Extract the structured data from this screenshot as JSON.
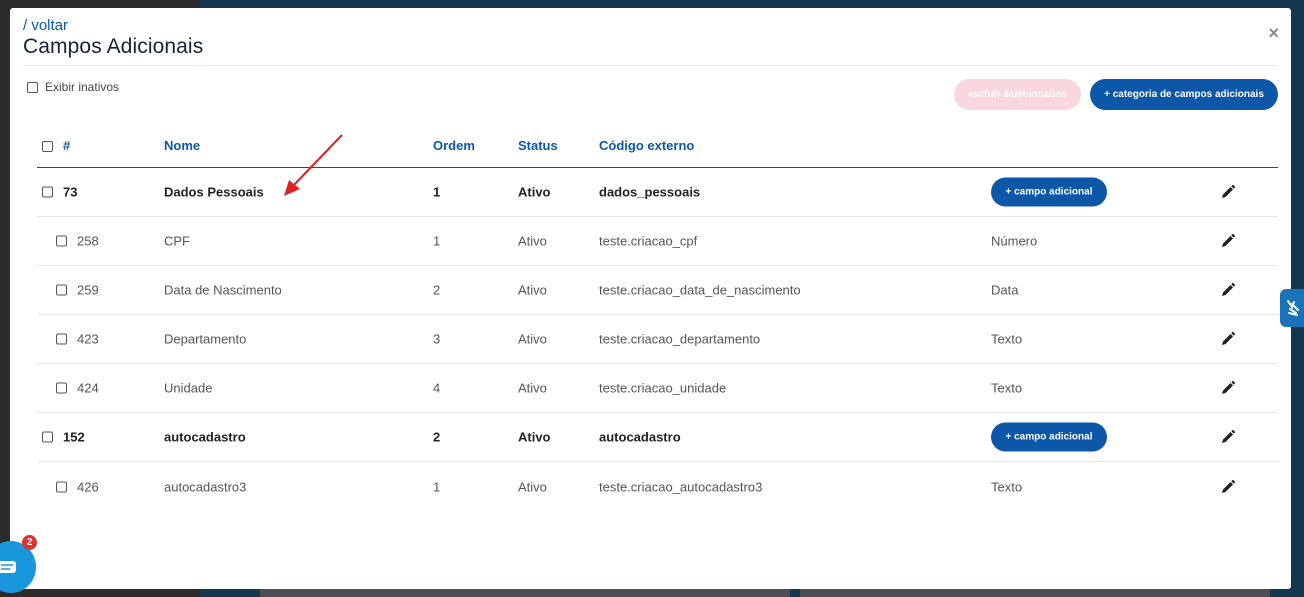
{
  "header": {
    "back_label": "/ voltar",
    "title": "Campos Adicionais",
    "close_label": "×"
  },
  "filters": {
    "show_inactive_label": "Exibir inativos"
  },
  "actions": {
    "delete_selected_label": "excluir selecionados",
    "add_category_label": "+ categoria de campos adicionais",
    "add_field_label": "+ campo adicional"
  },
  "table": {
    "columns": {
      "id": "#",
      "name": "Nome",
      "order": "Ordem",
      "status": "Status",
      "external_code": "Código externo"
    },
    "rows": [
      {
        "kind": "category",
        "id": "73",
        "name": "Dados Pessoais",
        "order": "1",
        "status": "Ativo",
        "code": "dados_pessoais",
        "type": ""
      },
      {
        "kind": "field",
        "id": "258",
        "name": "CPF",
        "order": "1",
        "status": "Ativo",
        "code": "teste.criacao_cpf",
        "type": "Número"
      },
      {
        "kind": "field",
        "id": "259",
        "name": "Data de Nascimento",
        "order": "2",
        "status": "Ativo",
        "code": "teste.criacao_data_de_nascimento",
        "type": "Data"
      },
      {
        "kind": "field",
        "id": "423",
        "name": "Departamento",
        "order": "3",
        "status": "Ativo",
        "code": "teste.criacao_departamento",
        "type": "Texto"
      },
      {
        "kind": "field",
        "id": "424",
        "name": "Unidade",
        "order": "4",
        "status": "Ativo",
        "code": "teste.criacao_unidade",
        "type": "Texto"
      },
      {
        "kind": "category",
        "id": "152",
        "name": "autocadastro",
        "order": "2",
        "status": "Ativo",
        "code": "autocadastro",
        "type": ""
      },
      {
        "kind": "field",
        "id": "426",
        "name": "autocadastro3",
        "order": "1",
        "status": "Ativo",
        "code": "teste.criacao_autocadastro3",
        "type": "Texto"
      }
    ]
  },
  "chat": {
    "badge_count": "2"
  },
  "colors": {
    "primary": "#0d57a8",
    "danger_disabled": "#f8d7de",
    "annotation_arrow": "#e02020"
  }
}
